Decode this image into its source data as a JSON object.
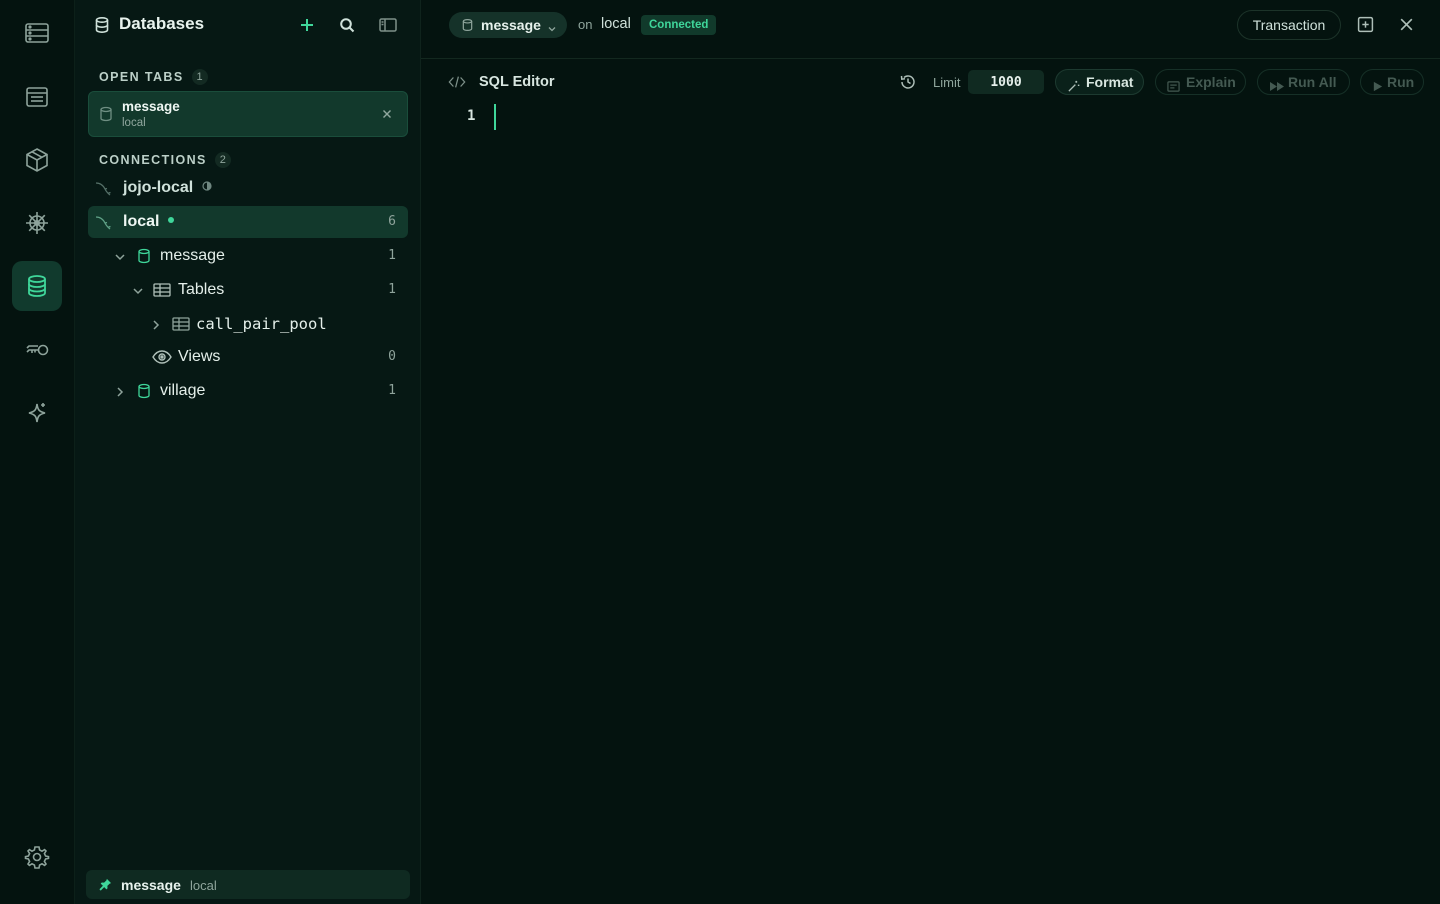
{
  "rail": {
    "items": [
      {
        "name": "servers-icon"
      },
      {
        "name": "document-list-icon"
      },
      {
        "name": "package-cube-icon"
      },
      {
        "name": "helm-wheel-icon"
      },
      {
        "name": "database-icon",
        "active": true
      },
      {
        "name": "key-icon"
      },
      {
        "name": "sparkle-icon"
      }
    ],
    "settings_icon": "gear-icon"
  },
  "sidebar": {
    "title": "Databases",
    "open_tabs": {
      "label": "OPEN TABS",
      "count": "1",
      "items": [
        {
          "title": "message",
          "subtitle": "local"
        }
      ]
    },
    "connections": {
      "label": "CONNECTIONS",
      "count": "2",
      "items": [
        {
          "name": "jojo-local",
          "status": "partial"
        },
        {
          "name": "local",
          "status": "connected",
          "count": "6"
        }
      ]
    },
    "tree": {
      "message": {
        "label": "message",
        "count": "1"
      },
      "tables": {
        "label": "Tables",
        "count": "1"
      },
      "table_item": {
        "label": "call_pair_pool"
      },
      "views": {
        "label": "Views",
        "count": "0"
      },
      "village": {
        "label": "village",
        "count": "1"
      }
    },
    "pinned": {
      "title": "message",
      "subtitle": "local"
    }
  },
  "topbar": {
    "database": "message",
    "on": "on",
    "connection": "local",
    "status": "Connected",
    "transaction": "Transaction"
  },
  "editor": {
    "title": "SQL Editor",
    "limit_label": "Limit",
    "limit_value": "1000",
    "format": "Format",
    "explain": "Explain",
    "run_all": "Run All",
    "run": "Run",
    "line_number": "1"
  },
  "colors": {
    "background": "#04130f",
    "accent": "#3fd69a",
    "selected": "#12392c"
  }
}
